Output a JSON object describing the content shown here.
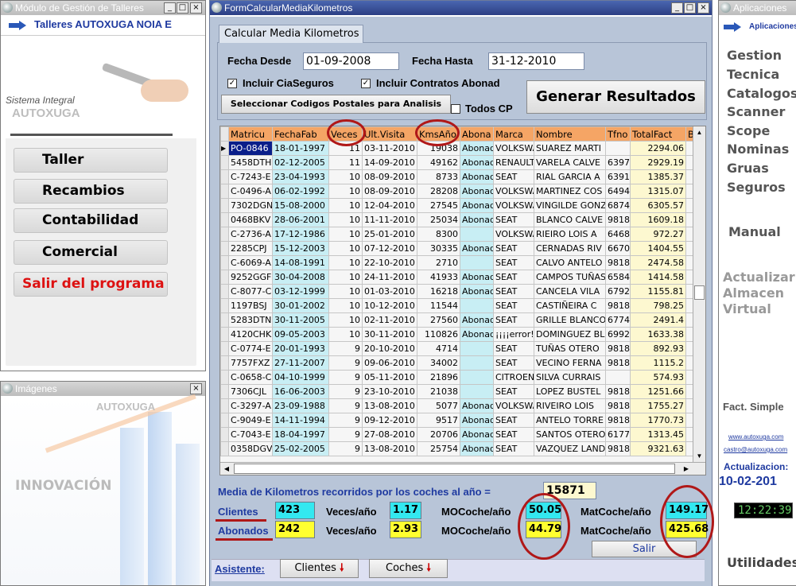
{
  "left_top": {
    "title": "Módulo de Gestión de Talleres",
    "header": "Talleres AUTOXUGA NOIA E",
    "logo_line1": "Sistema Integral",
    "logo_line2": "AUTOXUGA",
    "buttons": [
      "Taller",
      "Recambios",
      "Contabilidad",
      "Comercial",
      "Salir del programa"
    ]
  },
  "left_bottom": {
    "title": "Imágenes",
    "brand": "AUTOXUGA",
    "slogan": "INNOVACIÓN"
  },
  "right": {
    "title": "Aplicaciones",
    "header": "Aplicaciones",
    "links": [
      "Gestion",
      "Tecnica",
      "Catalogos",
      "Scanner",
      "Scope",
      "Nominas",
      "Gruas",
      "Seguros"
    ],
    "manual": "Manual",
    "actualizar": [
      "Actualizar",
      "Almacen",
      "Virtual"
    ],
    "fact": "Fact. Simple",
    "web": "www.autoxuga.com",
    "email": "castro@autoxuga.com",
    "update_label": "Actualizacion:",
    "update_date": "10-02-201",
    "clock": "12:22:39",
    "utilidades": "Utilidades"
  },
  "main": {
    "title": "FormCalcularMediaKilometros",
    "tab": "Calcular Media Kilometros",
    "fecha_desde_label": "Fecha Desde",
    "fecha_desde": "01-09-2008",
    "fecha_hasta_label": "Fecha Hasta",
    "fecha_hasta": "31-12-2010",
    "chk1": "Incluir CiaSeguros",
    "chk2": "Incluir Contratos Abonad",
    "select_cp": "Seleccionar Codigos Postales para Analisis",
    "todos_cp": "Todos CP",
    "generar": "Generar Resultados",
    "columns": [
      "Matricu",
      "FechaFab",
      "Veces",
      "Ult.Visita",
      "KmsAño",
      "Abona",
      "Marca",
      "Nombre",
      "Tfno",
      "TotalFact",
      "B"
    ],
    "rows": [
      [
        "PO-0846",
        "18-01-1997",
        "11",
        "03-11-2010",
        "19038",
        "Abonad",
        "VOLKSWA",
        "SUAREZ MARTI",
        "",
        "2294.06"
      ],
      [
        "5458DTH",
        "02-12-2005",
        "11",
        "14-09-2010",
        "49162",
        "Abonad",
        "RENAULT",
        "VARELA CALVE",
        "6397",
        "2929.19"
      ],
      [
        "C-7243-E",
        "23-04-1993",
        "10",
        "08-09-2010",
        "8733",
        "Abonad",
        "SEAT",
        "RIAL GARCIA A",
        "6391",
        "1385.37"
      ],
      [
        "C-0496-A",
        "06-02-1992",
        "10",
        "08-09-2010",
        "28208",
        "Abonad",
        "VOLKSWA",
        "MARTINEZ COS",
        "6494",
        "1315.07"
      ],
      [
        "7302DGN",
        "15-08-2000",
        "10",
        "12-04-2010",
        "27545",
        "Abonad",
        "VOLKSWA",
        "VINGILDE GONZ",
        "6874",
        "6305.57"
      ],
      [
        "0468BKV",
        "28-06-2001",
        "10",
        "11-11-2010",
        "25034",
        "Abonad",
        "SEAT",
        "BLANCO CALVE",
        "9818",
        "1609.18"
      ],
      [
        "C-2736-A",
        "17-12-1986",
        "10",
        "25-01-2010",
        "8300",
        "",
        "VOLKSWA",
        "RIEIRO LOIS A",
        "6468",
        "972.27"
      ],
      [
        "2285CPJ",
        "15-12-2003",
        "10",
        "07-12-2010",
        "30335",
        "Abonad",
        "SEAT",
        "CERNADAS RIV",
        "6670",
        "1404.55"
      ],
      [
        "C-6069-A",
        "14-08-1991",
        "10",
        "22-10-2010",
        "2710",
        "",
        "SEAT",
        "CALVO ANTELO",
        "9818",
        "2474.58"
      ],
      [
        "9252GGF",
        "30-04-2008",
        "10",
        "24-11-2010",
        "41933",
        "Abonad",
        "SEAT",
        "CAMPOS TUÑAS",
        "6584",
        "1414.58"
      ],
      [
        "C-8077-C",
        "03-12-1999",
        "10",
        "01-03-2010",
        "16218",
        "Abonad",
        "SEAT",
        "CANCELA VILA",
        "6792",
        "1155.81"
      ],
      [
        "1197BSJ",
        "30-01-2002",
        "10",
        "10-12-2010",
        "11544",
        "",
        "SEAT",
        "CASTIÑEIRA C",
        "9818",
        "798.25"
      ],
      [
        "5283DTN",
        "30-11-2005",
        "10",
        "02-11-2010",
        "27560",
        "Abonad",
        "SEAT",
        "GRILLE BLANCO",
        "6774",
        "2491.4"
      ],
      [
        "4120CHK",
        "09-05-2003",
        "10",
        "30-11-2010",
        "110826",
        "Abonad",
        "¡¡¡¡error!!",
        "DOMINGUEZ BL",
        "6992",
        "1633.38"
      ],
      [
        "C-0774-E",
        "20-01-1993",
        "9",
        "20-10-2010",
        "4714",
        "",
        "SEAT",
        "TUÑAS OTERO",
        "9818",
        "892.93"
      ],
      [
        "7757FXZ",
        "27-11-2007",
        "9",
        "09-06-2010",
        "34002",
        "",
        "SEAT",
        "VECINO FERNA",
        "9818",
        "1115.2"
      ],
      [
        "C-0658-C",
        "04-10-1999",
        "9",
        "05-11-2010",
        "21896",
        "",
        "CITROEN",
        "SILVA CURRAIS",
        "",
        "574.93"
      ],
      [
        "7306CJL",
        "16-06-2003",
        "9",
        "23-10-2010",
        "21038",
        "",
        "SEAT",
        "LOPEZ BUSTEL",
        "9818",
        "1251.66"
      ],
      [
        "C-3297-A",
        "23-09-1988",
        "9",
        "13-08-2010",
        "5077",
        "Abonad",
        "VOLKSWA",
        "RIVEIRO LOIS",
        "9818",
        "1755.27"
      ],
      [
        "C-9049-E",
        "14-11-1994",
        "9",
        "09-12-2010",
        "9517",
        "Abonad",
        "SEAT",
        "ANTELO TORRE",
        "9818",
        "1770.73"
      ],
      [
        "C-7043-E",
        "18-04-1997",
        "9",
        "27-08-2010",
        "20706",
        "Abonad",
        "SEAT",
        "SANTOS OTERO",
        "6177",
        "1313.45"
      ],
      [
        "0358DGV",
        "25-02-2005",
        "9",
        "13-08-2010",
        "25754",
        "Abonad",
        "SEAT",
        "VAZQUEZ LAND",
        "9818",
        "9321.63"
      ]
    ],
    "media_label": "Media de Kilometros recorridos por los coches al año =",
    "media_value": "15871",
    "clientes_label": "Clientes",
    "clientes_value": "423",
    "abonados_label": "Abonados",
    "abonados_value": "242",
    "veces_label": "Veces/año",
    "veces_clientes": "1.17",
    "veces_abonados": "2.93",
    "mo_label": "MOCoche/año",
    "mo_clientes": "50.05",
    "mo_abonados": "44.79",
    "mat_label": "MatCoche/año",
    "mat_clientes": "149.17",
    "mat_abonados": "425.68",
    "salir": "Salir",
    "asistente": "Asistente:",
    "btn_clientes": "Clientes",
    "btn_coches": "Coches"
  }
}
